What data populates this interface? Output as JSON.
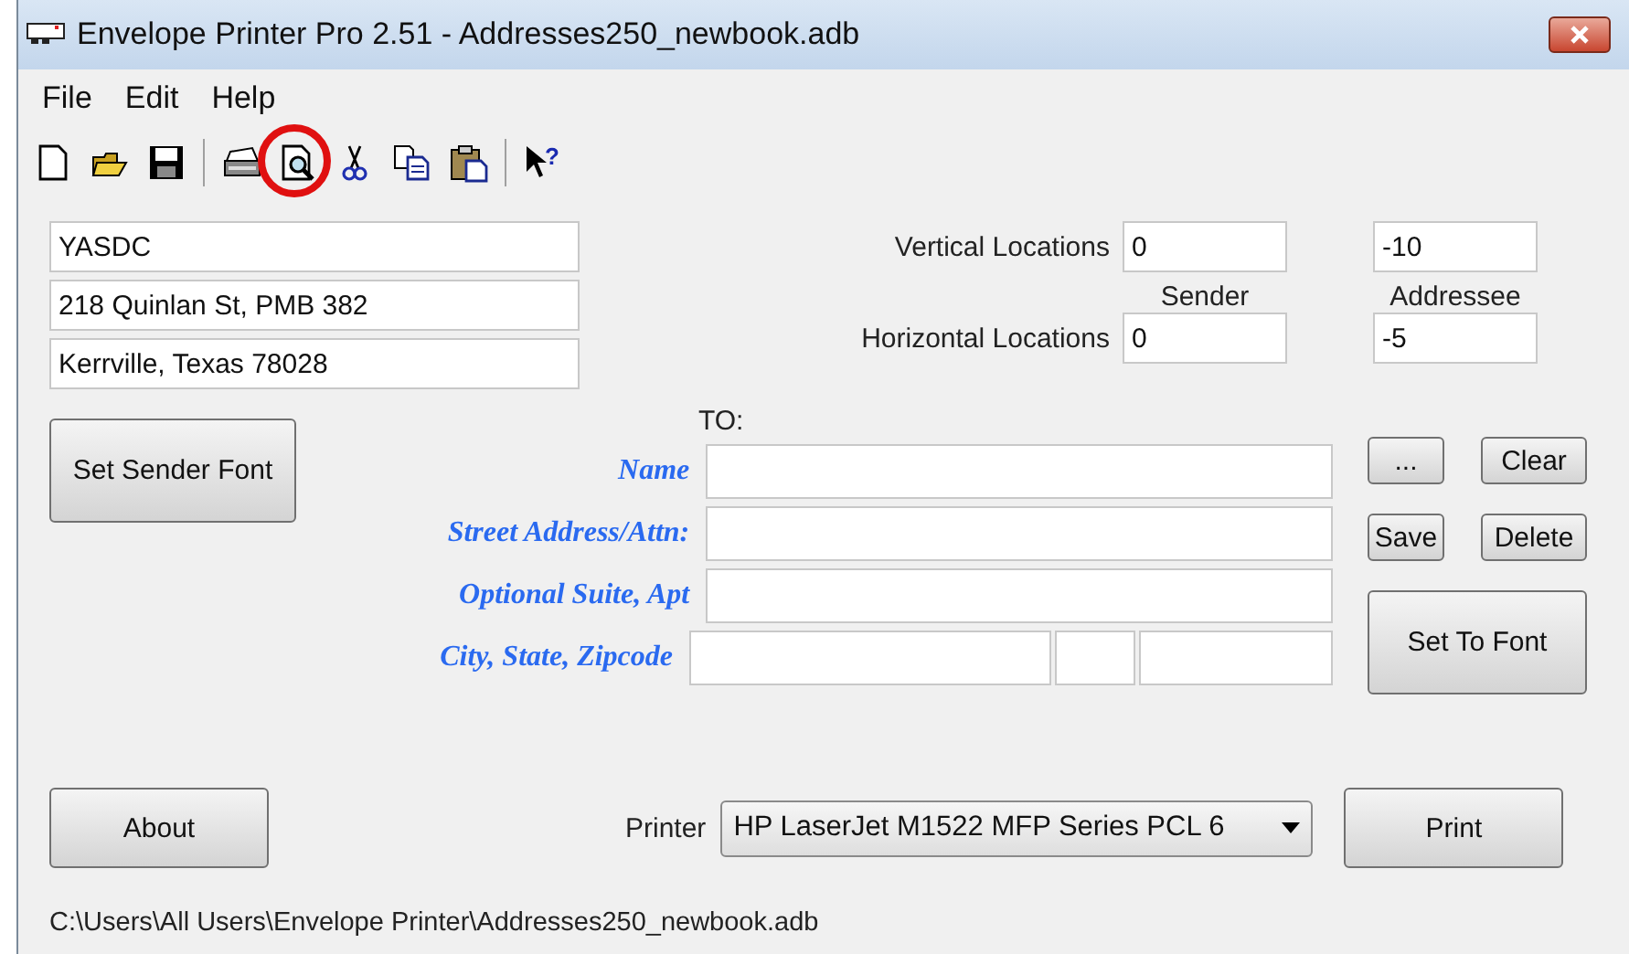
{
  "window": {
    "title": "Envelope Printer Pro 2.51 - Addresses250_newbook.adb"
  },
  "menu": [
    "File",
    "Edit",
    "Help"
  ],
  "toolbar": [
    {
      "kind": "new",
      "highlighted": false
    },
    {
      "kind": "open",
      "highlighted": false
    },
    {
      "kind": "save",
      "highlighted": false
    },
    {
      "kind": "separator"
    },
    {
      "kind": "print",
      "highlighted": false
    },
    {
      "kind": "preview",
      "highlighted": true
    },
    {
      "kind": "cut",
      "highlighted": false
    },
    {
      "kind": "copy",
      "highlighted": false
    },
    {
      "kind": "paste",
      "highlighted": false
    },
    {
      "kind": "separator"
    },
    {
      "kind": "help",
      "highlighted": false,
      "glyph": "?"
    }
  ],
  "sender": {
    "lines": [
      "YASDC",
      "218 Quinlan St, PMB 382",
      "Kerrville, Texas 78028"
    ],
    "font_button": "Set Sender Font"
  },
  "locations": {
    "vertical_label": "Vertical Locations",
    "horizontal_label": "Horizontal Locations",
    "sender_header": "Sender",
    "addressee_header": "Addressee",
    "vertical": {
      "sender": "0",
      "addressee": "-10"
    },
    "horizontal": {
      "sender": "0",
      "addressee": "-5"
    }
  },
  "to": {
    "label": "TO:",
    "fields": [
      {
        "label": "Name",
        "kind": "single"
      },
      {
        "label": "Street Address/Attn:",
        "kind": "single"
      },
      {
        "label": "Optional Suite, Apt",
        "kind": "single"
      },
      {
        "label": "City, State, Zipcode",
        "kind": "city_state_zip"
      }
    ]
  },
  "buttons": {
    "browse": "...",
    "clear": "Clear",
    "save": "Save",
    "delete": "Delete",
    "set_to_font": "Set To Font",
    "about": "About",
    "print": "Print"
  },
  "printer": {
    "label": "Printer",
    "value": "HP LaserJet M1522 MFP Series PCL 6"
  },
  "status_bar": "C:\\Users\\All Users\\Envelope Printer\\Addresses250_newbook.adb"
}
